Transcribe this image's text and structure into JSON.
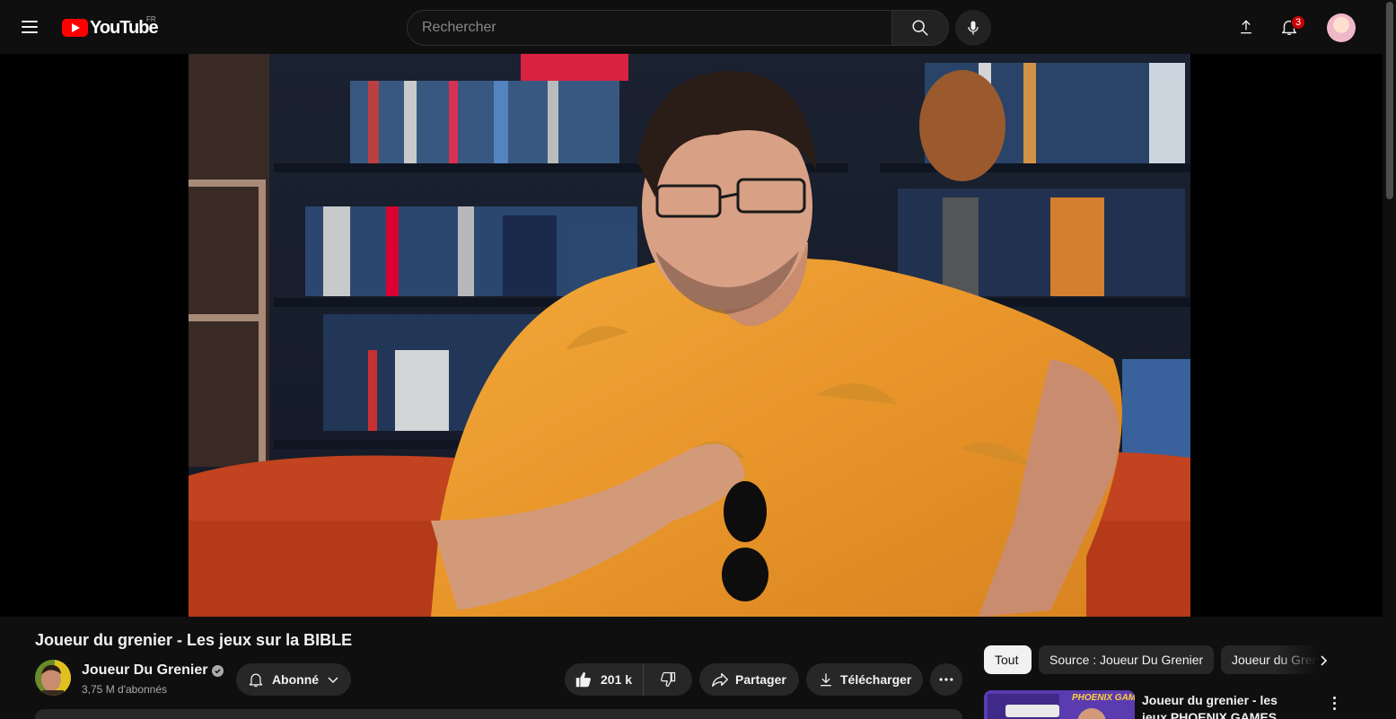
{
  "header": {
    "logo_text": "YouTube",
    "region": "FR",
    "search_placeholder": "Rechercher",
    "notification_count": "3"
  },
  "video": {
    "title": "Joueur du grenier - Les jeux sur la BIBLE"
  },
  "channel": {
    "name": "Joueur Du Grenier",
    "subscribers": "3,75 M d'abonnés"
  },
  "actions": {
    "subscribed_label": "Abonné",
    "like_count": "201 k",
    "share_label": "Partager",
    "download_label": "Télécharger"
  },
  "chips": [
    {
      "label": "Tout",
      "active": true
    },
    {
      "label": "Source : Joueur Du Grenier",
      "active": false
    },
    {
      "label": "Joueur du Grenier",
      "active": false
    }
  ],
  "recommended": [
    {
      "title": "Joueur du grenier - les jeux PHOENIX GAMES",
      "thumb_text": "PHOENIX GAMES"
    }
  ],
  "colors": {
    "background": "#0f0f0f",
    "brand_red": "#ff0000",
    "badge_red": "#cc0000",
    "pill": "#272727"
  }
}
